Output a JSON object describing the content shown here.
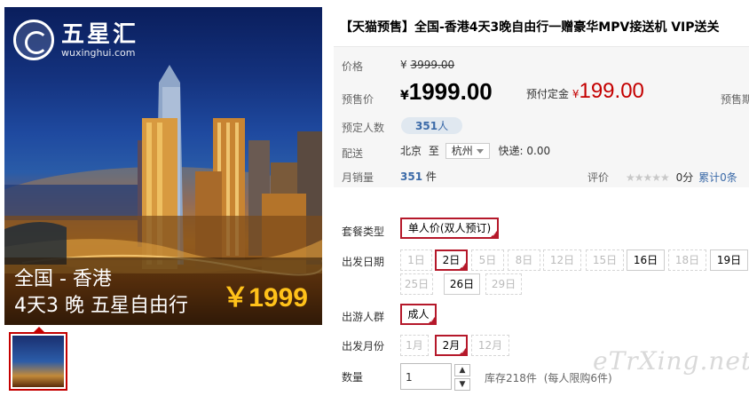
{
  "hero": {
    "logo_cn": "五星汇",
    "logo_url": "wuxinghui.com",
    "caption_line1": "全国 - 香港",
    "caption_line2": "4天3 晚  五星自由行",
    "caption_price": "￥1999"
  },
  "product": {
    "title": "【天猫预售】全国-香港4天3晚自由行一赠豪华MPV接送机 VIP送关"
  },
  "price": {
    "label": "价格",
    "currency": "¥",
    "original": "3999.00",
    "presale_label": "预售价",
    "presale_currency": "¥",
    "presale_value": "1999.00",
    "deposit_label": "预付定金",
    "deposit_currency": "¥",
    "deposit_value": "199.00",
    "presale_period_label": "预售期"
  },
  "booking": {
    "label": "预定人数",
    "count": "351",
    "unit": "人"
  },
  "shipping": {
    "label": "配送",
    "from": "北京",
    "to_word": "至",
    "destination": "杭州",
    "express_label": "快递:",
    "express_fee": "0.00"
  },
  "sales": {
    "label": "月销量",
    "count": "351",
    "unit": "件",
    "review_label": "评价",
    "stars": "★★★★★",
    "score": "0分",
    "total_reviews": "累计0条"
  },
  "options": {
    "package_label": "套餐类型",
    "package_value": "单人价(双人预订)",
    "date_label": "出发日期",
    "dates": [
      {
        "text": "1日",
        "state": "disabled"
      },
      {
        "text": "2日",
        "state": "selected"
      },
      {
        "text": "5日",
        "state": "disabled"
      },
      {
        "text": "8日",
        "state": "disabled"
      },
      {
        "text": "12日",
        "state": "disabled"
      },
      {
        "text": "15日",
        "state": "disabled"
      },
      {
        "text": "16日",
        "state": "normal"
      },
      {
        "text": "18日",
        "state": "disabled"
      },
      {
        "text": "19日",
        "state": "normal"
      },
      {
        "text": "25日",
        "state": "disabled"
      },
      {
        "text": "26日",
        "state": "normal"
      },
      {
        "text": "29日",
        "state": "disabled"
      }
    ],
    "traveler_label": "出游人群",
    "traveler_value": "成人",
    "month_label": "出发月份",
    "months": [
      {
        "text": "1月",
        "state": "disabled"
      },
      {
        "text": "2月",
        "state": "selected"
      },
      {
        "text": "12月",
        "state": "disabled"
      }
    ]
  },
  "quantity": {
    "label": "数量",
    "value": "1",
    "stock_text": "库存218件",
    "limit_text": "(每人限购6件)"
  },
  "watermark": "eTrXing.net",
  "colors": {
    "accent_red": "#c40000",
    "chip_selected_border": "#b5182a",
    "link_blue": "#3b6aa8",
    "price_bg": "#f6f6f6"
  }
}
